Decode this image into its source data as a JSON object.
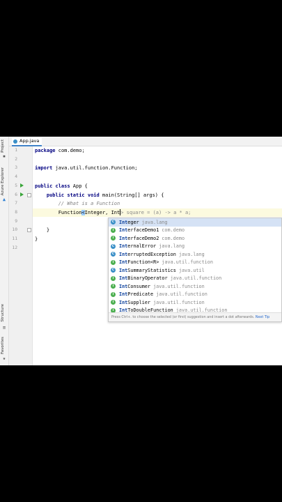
{
  "sidebar": {
    "project_label": "Project",
    "azure_label": "Azure Explorer",
    "structure_label": "Structure",
    "favorites_label": "Favorites"
  },
  "tab": {
    "label": "App.java"
  },
  "lines": [
    "1",
    "2",
    "3",
    "4",
    "5",
    "6",
    "7",
    "8",
    "9",
    "10",
    "11",
    "12"
  ],
  "code": {
    "l1_kw": "package",
    "l1_rest": " com.demo;",
    "l3_kw": "import",
    "l3_rest": " java.util.function.Function;",
    "l5_kw": "public class",
    "l5_rest": " App {",
    "l6_kw": "public static void",
    "l6_rest": " main(String[] args) {",
    "l7": "// What is a Function",
    "l8_a": "Function",
    "l8_b": "<",
    "l8_c": "Integer, Int",
    "l8_d": "> square = (a) -> a * a;",
    "l10": "}",
    "l11": "}"
  },
  "completion": {
    "items": [
      {
        "prefix": "Int",
        "rest": "eger",
        "pkg": "java.lang",
        "icon": "c"
      },
      {
        "prefix": "Int",
        "rest": "erfaceDemo1",
        "pkg": "com.demo",
        "icon": "i"
      },
      {
        "prefix": "Int",
        "rest": "erfaceDemo2",
        "pkg": "com.demo",
        "icon": "i"
      },
      {
        "prefix": "Int",
        "rest": "ernalError",
        "pkg": "java.lang",
        "icon": "c"
      },
      {
        "prefix": "Int",
        "rest": "erruptedException",
        "pkg": "java.lang",
        "icon": "c"
      },
      {
        "prefix": "Int",
        "rest": "Function<R>",
        "pkg": "java.util.function",
        "icon": "i"
      },
      {
        "prefix": "Int",
        "rest": "SummaryStatistics",
        "pkg": "java.util",
        "icon": "c"
      },
      {
        "prefix": "Int",
        "rest": "BinaryOperator",
        "pkg": "java.util.function",
        "icon": "i"
      },
      {
        "prefix": "Int",
        "rest": "Consumer",
        "pkg": "java.util.function",
        "icon": "i"
      },
      {
        "prefix": "Int",
        "rest": "Predicate",
        "pkg": "java.util.function",
        "icon": "i"
      },
      {
        "prefix": "Int",
        "rest": "Supplier",
        "pkg": "java.util.function",
        "icon": "i"
      },
      {
        "prefix": "Int",
        "rest": "ToDoubleFunction",
        "pkg": "java.util.function",
        "icon": "i"
      }
    ],
    "hint": "Press Ctrl+. to choose the selected (or first) suggestion and insert a dot afterwards.",
    "next_tip": "Next Tip"
  }
}
